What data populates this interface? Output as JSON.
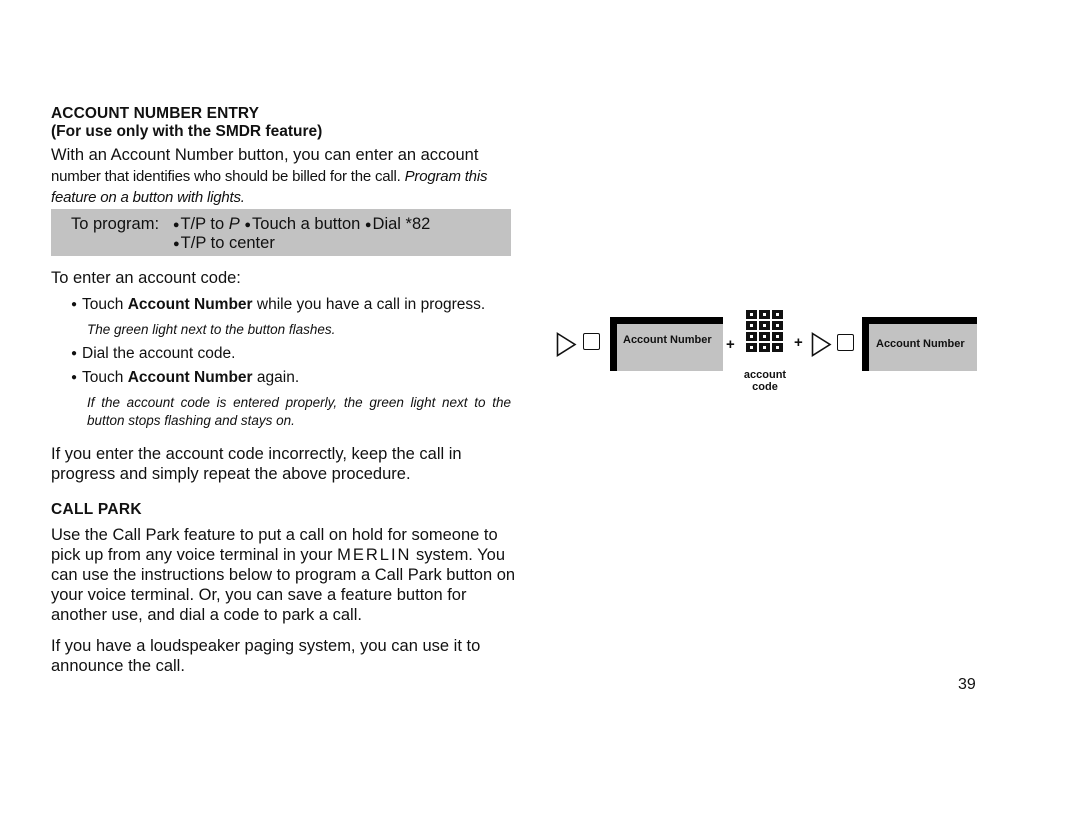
{
  "section1": {
    "title": "ACCOUNT NUMBER ENTRY",
    "subtitle": "(For use only with the SMDR feature)",
    "intro_line1": "With an Account Number button, you can enter an account",
    "intro_line2": "number that identifies who should be billed for the call.",
    "intro_italic": "Program this feature on a button with lights.",
    "program": {
      "label": "To program:",
      "step1_prefix": "T/P to",
      "step1_pos": "P",
      "step2": "Touch a button",
      "step3": "Dial *82",
      "step4": "T/P to center"
    },
    "enter_label": "To enter an account code:",
    "steps": [
      {
        "pre": "Touch ",
        "bold": "Account Number",
        "post": " while you have a call in progress.",
        "note": "The green light next to the button flashes."
      },
      {
        "pre": "Dial the account code.",
        "bold": "",
        "post": "",
        "note": ""
      },
      {
        "pre": "Touch ",
        "bold": "Account Number",
        "post": " again.",
        "note": "If the account code is entered properly, the green light next to the button stops flashing and stays on."
      }
    ],
    "retry_text": "If you enter the account code incorrectly, keep the call in progress and simply repeat the above procedure."
  },
  "section2": {
    "title": "CALL PARK",
    "para1_pre": "Use the Call Park feature to put a call on hold for someone to pick up from any voice terminal in your ",
    "para1_brand": "MERLIN",
    "para1_post": " system. You can use the instructions below to program a Call Park button on your voice terminal. Or, you can save a feature button for another use, and dial a code to park a call.",
    "para2": "If you have a loudspeaker paging system, you can use it to announce the call."
  },
  "diagram": {
    "button1_label": "Account Number",
    "plus": "+",
    "dialpad_label_line1": "account",
    "dialpad_label_line2": "code",
    "button2_label": "Account Number"
  },
  "page_number": "39"
}
